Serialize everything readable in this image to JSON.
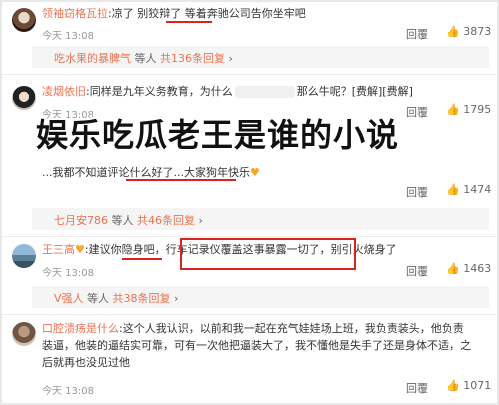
{
  "comments": [
    {
      "username": "领袖窃格瓦拉",
      "text": ":凉了 别狡辩了 等着奔驰公司告你坐牢吧",
      "time": "今天 13:08",
      "reply": "回覆",
      "likes": "3873"
    },
    {
      "username": "凌烟依旧",
      "text": ":同样是九年义务教育，为什么",
      "text_end": "那么牛呢？[费解][费解]",
      "time": "今天 13:08",
      "reply": "回覆",
      "likes": "1795"
    },
    {
      "username": "",
      "text": "...我都不知道评论什么好了...大家狗年快乐",
      "time": "",
      "reply": "回覆",
      "likes": "1474"
    },
    {
      "username": "王三高",
      "text": ":建议你隐身吧，行车记录仪覆盖这事暴露一切了，别引火烧身了",
      "time": "今天 13:08",
      "reply": "回覆",
      "likes": "1463"
    },
    {
      "username": "口腔溃疡是什么",
      "text_lines": [
        ":这个人我认识，以前和我一起在充气娃娃场上班，我负责装头，他负责",
        "装逼，他装的逼结实可靠，可有一次他把逼装大了，我不懂他是失手了还是身体不适，之",
        "后就再也没见过他"
      ],
      "time": "今天 13:08",
      "reply": "回覆",
      "likes": "1071"
    }
  ],
  "sub_replies": [
    {
      "user": "吃水果的暴脾气",
      "mid": "等人",
      "count": "共136条回复"
    },
    {
      "user": "七月安786",
      "mid": "等人",
      "count": "共46条回复"
    },
    {
      "user": "V强人",
      "mid": "等人",
      "count": "共38条回复"
    }
  ],
  "overlay_title": "娱乐吃瓜老王是谁的小说",
  "colors": {
    "username": "#eb7350",
    "highlight_box": "#d8231f",
    "count": "#eb7350"
  }
}
